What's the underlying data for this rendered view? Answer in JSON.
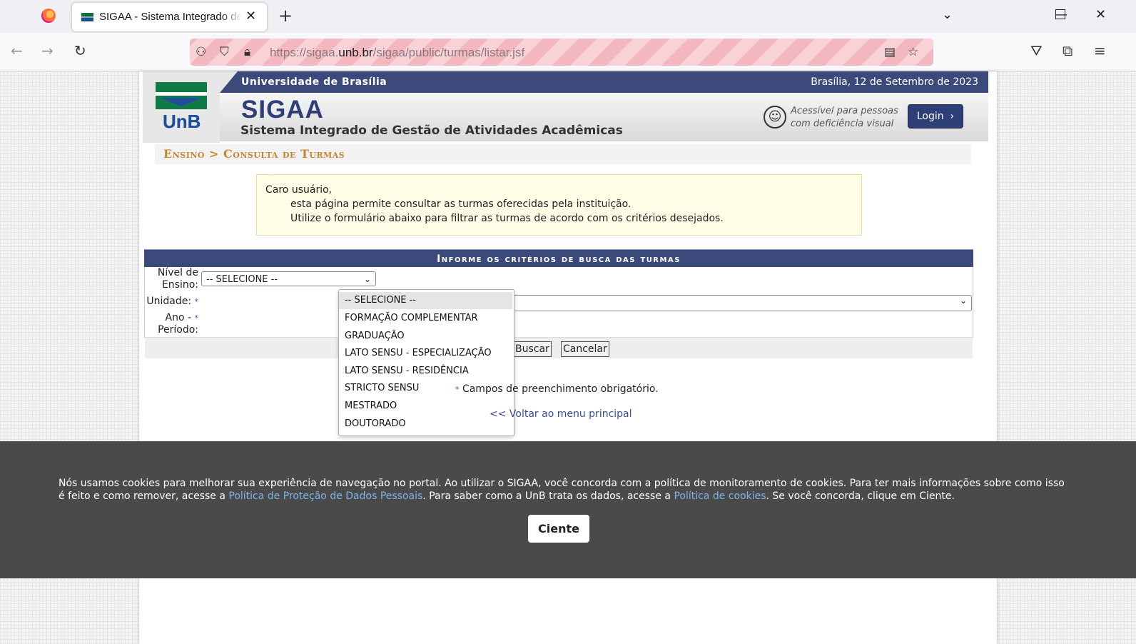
{
  "browser": {
    "tab_title": "SIGAA - Sistema Integrado de Gestão de Atividades Acadêmicas",
    "tab_close": "✕",
    "new_tab": "+",
    "url_prefix": "https://sigaa.",
    "url_domain": "unb.br",
    "url_path": "/sigaa/public/turmas/listar.jsf",
    "icons": [
      "back-icon",
      "forward-icon",
      "reload-icon",
      "shield-icon",
      "lock-icon",
      "reader-icon",
      "star-icon",
      "pocket-icon",
      "extensions-icon",
      "menu-icon",
      "list-tabs-icon",
      "minimize-icon",
      "maximize-icon",
      "close-icon"
    ]
  },
  "header": {
    "university": "Universidade de Brasília",
    "date": "Brasília, 12 de Setembro de 2023",
    "logo_text": "UnB",
    "system_name": "SIGAA",
    "system_full": "Sistema Integrado de Gestão de Atividades Acadêmicas",
    "accessibility_line1": "Acessível para pessoas",
    "accessibility_line2": "com deficiência visual",
    "login_label": "Login",
    "login_arrow": "›"
  },
  "breadcrumb": "Ensino > Consulta de Turmas",
  "info": {
    "greeting": "Caro usuário,",
    "line1": "esta página permite consultar as turmas oferecidas pela instituição.",
    "line2": "Utilize o formulário abaixo para filtrar as turmas de acordo com os critérios desejados."
  },
  "form": {
    "title": "Informe os critérios de busca das turmas",
    "nivel_label_1": "Nível de",
    "nivel_label_2": "Ensino:",
    "nivel_selected": "-- SELECIONE --",
    "unidade_label": "Unidade:",
    "ano_label_1": "Ano -",
    "ano_label_2": "Período:",
    "required_marker": "*",
    "buscar": "Buscar",
    "cancelar": "Cancelar",
    "nivel_options": [
      "-- SELECIONE --",
      "FORMAÇÃO COMPLEMENTAR",
      "GRADUAÇÃO",
      "LATO SENSU - ESPECIALIZAÇÃO",
      "LATO SENSU - RESIDÊNCIA",
      "STRICTO SENSU",
      "MESTRADO",
      "DOUTORADO"
    ]
  },
  "footer": {
    "required_note": "Campos de preenchimento obrigatório.",
    "back_link": "<< Voltar ao menu principal"
  },
  "cookie": {
    "text_1": "Nós usamos cookies para melhorar sua experiência de navegação no portal. Ao utilizar o SIGAA, você concorda com a política de monitoramento de cookies. Para ter mais informações sobre como isso é feito e como remover, acesse a ",
    "link_1": "Política de Proteção de Dados Pessoais",
    "text_2": ". Para saber como a UnB trata os dados, acesse a ",
    "link_2": "Política de cookies",
    "text_3": ". Se você concorda, clique em Ciente.",
    "button": "Ciente"
  },
  "colors": {
    "header_blue": "#3b4a7a",
    "breadcrumb_orange": "#c8862a",
    "info_bg": "#fffde5",
    "cookie_bg": "#4a4a4a"
  }
}
